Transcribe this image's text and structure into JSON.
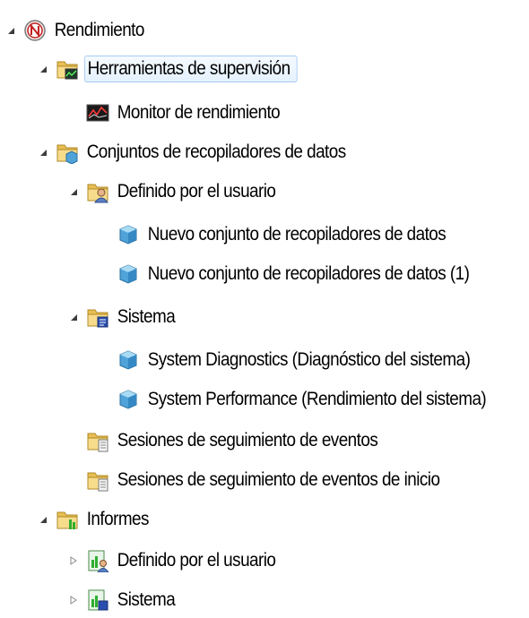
{
  "tree": {
    "root": {
      "label": "Rendimiento",
      "icon": "performance-gauge-icon",
      "state": "expanded"
    },
    "monitoring_tools": {
      "label": "Herramientas de supervisión",
      "icon": "folder-monitor-icon",
      "state": "expanded",
      "selected": true
    },
    "performance_monitor": {
      "label": "Monitor de rendimiento",
      "icon": "performance-monitor-icon"
    },
    "collector_sets": {
      "label": "Conjuntos de recopiladores de datos",
      "icon": "folder-collector-icon",
      "state": "expanded"
    },
    "user_defined": {
      "label": "Definido por el usuario",
      "icon": "folder-user-icon",
      "state": "expanded"
    },
    "new_set_1": {
      "label": "Nuevo conjunto de recopiladores de datos",
      "icon": "data-collector-set-icon"
    },
    "new_set_2": {
      "label": "Nuevo conjunto de recopiladores de datos (1)",
      "icon": "data-collector-set-icon"
    },
    "system": {
      "label": "Sistema",
      "icon": "folder-system-icon",
      "state": "expanded"
    },
    "system_diagnostics": {
      "label": "System Diagnostics (Diagnóstico del sistema)",
      "icon": "data-collector-set-icon"
    },
    "system_performance": {
      "label": "System Performance (Rendimiento del sistema)",
      "icon": "data-collector-set-icon"
    },
    "event_trace_sessions": {
      "label": "Sesiones de seguimiento de eventos",
      "icon": "folder-trace-icon"
    },
    "startup_trace_sessions": {
      "label": "Sesiones de seguimiento de eventos de inicio",
      "icon": "folder-trace-icon"
    },
    "reports": {
      "label": "Informes",
      "icon": "folder-reports-icon",
      "state": "expanded"
    },
    "reports_user_defined": {
      "label": "Definido por el usuario",
      "icon": "report-user-icon",
      "state": "collapsed"
    },
    "reports_system": {
      "label": "Sistema",
      "icon": "report-system-icon",
      "state": "collapsed"
    }
  },
  "colors": {
    "selection_border": "#a6ccf2",
    "selection_fill": "#e4f1fd",
    "folder": "#f2d47a",
    "collector_cube": "#4fa3d9"
  }
}
